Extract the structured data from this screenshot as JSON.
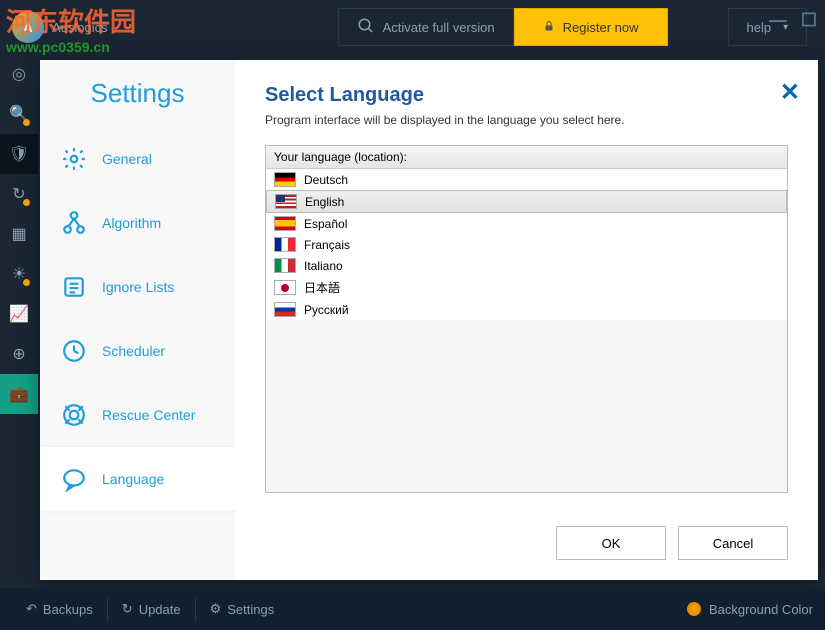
{
  "header": {
    "app_name": "Auslogics",
    "activate_label": "Activate full version",
    "register_label": "Register now",
    "help_label": "help"
  },
  "watermark": {
    "text": "河东软件园",
    "url": "www.pc0359.cn"
  },
  "settings": {
    "title": "Settings",
    "items": [
      {
        "label": "General"
      },
      {
        "label": "Algorithm"
      },
      {
        "label": "Ignore Lists"
      },
      {
        "label": "Scheduler"
      },
      {
        "label": "Rescue Center"
      },
      {
        "label": "Language"
      }
    ]
  },
  "language_panel": {
    "title": "Select Language",
    "subtitle": "Program interface will be displayed in the language you select here.",
    "list_header": "Your language (location):",
    "languages": [
      {
        "label": "Deutsch",
        "flag": "de"
      },
      {
        "label": "English",
        "flag": "us"
      },
      {
        "label": "Español",
        "flag": "es"
      },
      {
        "label": "Français",
        "flag": "fr"
      },
      {
        "label": "Italiano",
        "flag": "it"
      },
      {
        "label": "日本語",
        "flag": "jp"
      },
      {
        "label": "Русский",
        "flag": "ru"
      }
    ],
    "selected_index": 1,
    "ok_label": "OK",
    "cancel_label": "Cancel"
  },
  "footer": {
    "backups_label": "Backups",
    "update_label": "Update",
    "settings_label": "Settings",
    "bg_color_label": "Background Color"
  }
}
